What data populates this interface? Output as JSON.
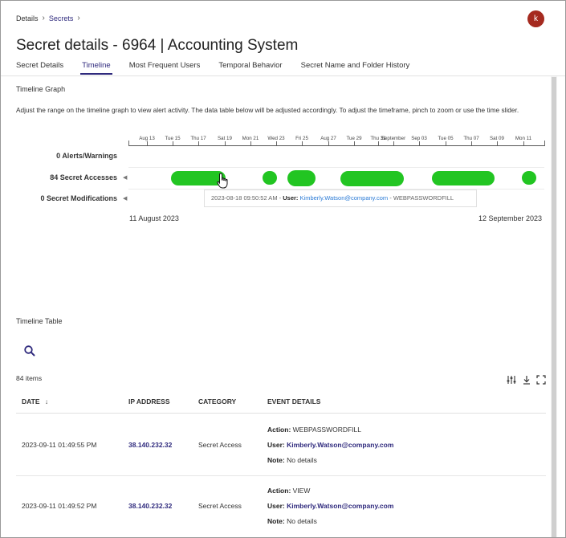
{
  "breadcrumb": {
    "items": [
      {
        "label": "Details"
      },
      {
        "label": "Secrets"
      }
    ]
  },
  "avatar": {
    "initial": "k",
    "color": "#a52a1f"
  },
  "page": {
    "title": "Secret details - 6964 | Accounting System"
  },
  "tabs": [
    {
      "label": "Secret Details",
      "active": false
    },
    {
      "label": "Timeline",
      "active": true
    },
    {
      "label": "Most Frequent Users",
      "active": false
    },
    {
      "label": "Temporal Behavior",
      "active": false
    },
    {
      "label": "Secret Name and Folder History",
      "active": false
    }
  ],
  "timeline_graph": {
    "title": "Timeline Graph",
    "description": "Adjust the range on the timeline graph to view alert activity. The data table below will be adjusted accordingly. To adjust the timeframe, pinch to zoom or use the time slider.",
    "axis_ticks": [
      "Aug 13",
      "Tue 15",
      "Thu 17",
      "Sat 19",
      "Mon 21",
      "Wed 23",
      "Fri 25",
      "Aug 27",
      "Tue 29",
      "Thu 31",
      "September",
      "Sep 03",
      "Tue 05",
      "Thu 07",
      "Sat 09",
      "Mon 11"
    ],
    "rows": [
      {
        "label": "0 Alerts/Warnings",
        "count": 0
      },
      {
        "label": "84 Secret Accesses",
        "count": 84
      },
      {
        "label": "0 Secret Modifications",
        "count": 0
      }
    ],
    "event_color": "#22c522",
    "tooltip": {
      "timestamp": "2023-08-18 09:50:52 AM",
      "user_label": "User:",
      "user": "Kimberly.Watson@company.com",
      "action": "WEBPASSWORDFILL"
    },
    "range_start": "11 August 2023",
    "range_end": "12 September 2023"
  },
  "timeline_table": {
    "title": "Timeline Table",
    "item_count": "84 items",
    "columns": [
      "DATE",
      "IP ADDRESS",
      "CATEGORY",
      "EVENT DETAILS"
    ],
    "sort_indicator": "↓",
    "rows": [
      {
        "date": "2023-09-11 01:49:55 PM",
        "ip": "38.140.232.32",
        "category": "Secret Access",
        "action_label": "Action:",
        "action": "WEBPASSWORDFILL",
        "user_label": "User:",
        "user": "Kimberly.Watson@company.com",
        "note_label": "Note:",
        "note": "No details"
      },
      {
        "date": "2023-09-11 01:49:52 PM",
        "ip": "38.140.232.32",
        "category": "Secret Access",
        "action_label": "Action:",
        "action": "VIEW",
        "user_label": "User:",
        "user": "Kimberly.Watson@company.com",
        "note_label": "Note:",
        "note": "No details"
      }
    ]
  },
  "colors": {
    "accent": "#2f2a7d",
    "link_blue": "#2b7bd6"
  }
}
